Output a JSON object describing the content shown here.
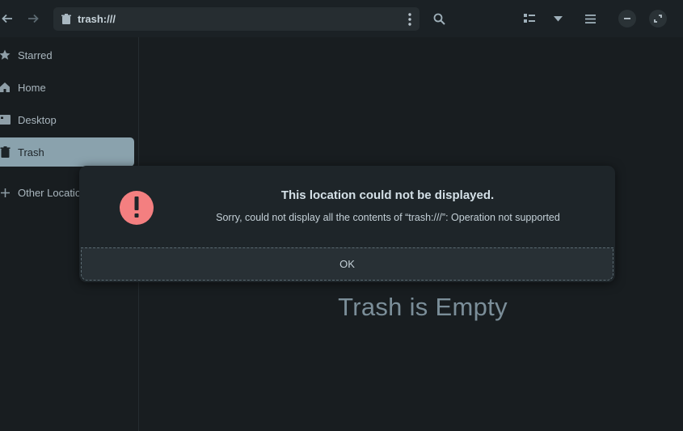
{
  "header": {
    "location_path": "trash:///"
  },
  "sidebar": {
    "items": [
      {
        "label": "Starred",
        "icon": "star-icon"
      },
      {
        "label": "Home",
        "icon": "home-icon"
      },
      {
        "label": "Desktop",
        "icon": "desktop-icon"
      },
      {
        "label": "Trash",
        "icon": "trash-icon",
        "active": true
      },
      {
        "label": "Other Locations",
        "icon": "plus-icon"
      }
    ]
  },
  "main": {
    "empty_title": "Trash is Empty"
  },
  "dialog": {
    "title": "This location could not be displayed.",
    "message": "Sorry, could not display all the contents of “trash:///”: Operation not supported",
    "ok_label": "OK",
    "icon": "warning-icon",
    "icon_color": "#f47f80"
  },
  "colors": {
    "accent": "#8aa2ad",
    "background": "#181d20"
  }
}
